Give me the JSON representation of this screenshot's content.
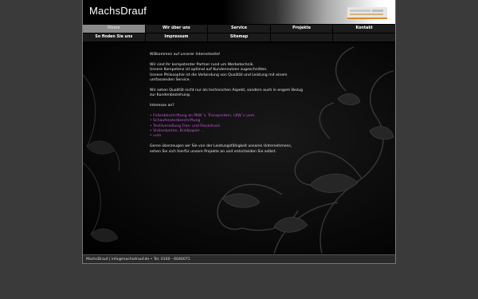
{
  "header": {
    "site_title": "MachsDrauf"
  },
  "nav": {
    "row1": [
      "Home",
      "Wir über uns",
      "Service",
      "Projekte",
      "Kontakt"
    ],
    "row2": [
      "So finden Sie uns",
      "Impressum",
      "Sitemap",
      "",
      ""
    ]
  },
  "content": {
    "welcome": "Willkommen auf unserer Internetseite!",
    "intro_lines": [
      "Wir sind Ihr kompetenter Partner rund um Werbetechnik.",
      "Unsere Kompetenz ist optimal auf Kundennutzen zugeschnitten.",
      "Unsere Philosophie ist die Verbindung von Qualität und Leistung mit einem",
      "umfassenden Service."
    ],
    "quality_lines": [
      "Wir sehen Qualität nicht nur als technischen Aspekt, sondern auch in engem Bezug",
      "zur Kundenbeziehung."
    ],
    "interest": "Interesse an?",
    "services": [
      "• Folienbeschriftung an PKW´s, Transportern, LKW´s uvm.",
      "• Schaufensterbeschriftung",
      "• Textilveredlung Flex- und Flockdruck",
      "• Visitenkarten, Briefpapier ...",
      "• uvm."
    ],
    "closing_lines": [
      "Gerne überzeugen wir Sie von der Leistungsfähigkeit unseres Unternehmens,",
      "sehen Sie sich hierfür unsere Projekte an und entscheiden Sie selbst."
    ]
  },
  "footer": {
    "text": "MachsDrauf  |  info@machsdrauf.de  •  Tel. 0160 - 6040071"
  },
  "colors": {
    "accent_link": "#c45ad6",
    "nav_active": "#8a8a8a",
    "logo_accent": "#d98a2a"
  }
}
